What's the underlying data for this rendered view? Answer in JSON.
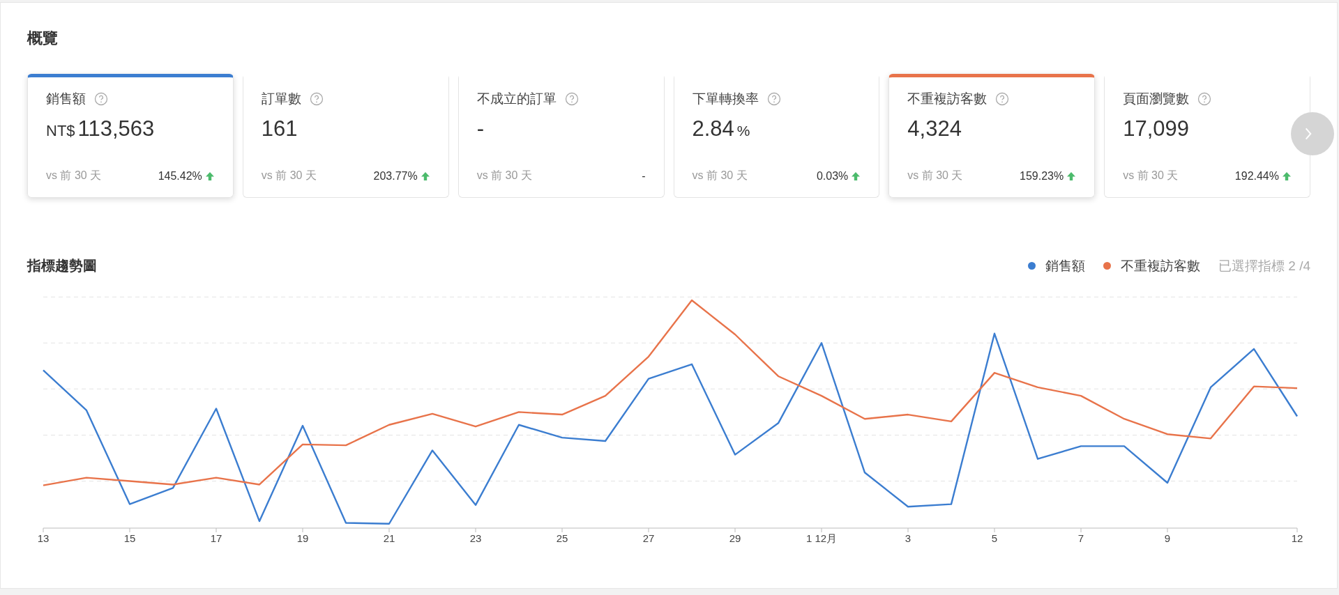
{
  "overview": {
    "title": "概覽",
    "cards": [
      {
        "label": "銷售額",
        "prefix": "NT$",
        "value": "113,563",
        "compare": "vs 前 30 天",
        "change": "145.42%",
        "rising": true,
        "selected": true,
        "color": "#3b7dd0"
      },
      {
        "label": "訂單數",
        "value": "161",
        "compare": "vs 前 30 天",
        "change": "203.77%",
        "rising": true,
        "selected": false
      },
      {
        "label": "不成立的訂單",
        "value": "-",
        "compare": "vs 前 30 天",
        "change": "-",
        "rising": false,
        "selected": false
      },
      {
        "label": "下單轉換率",
        "value": "2.84",
        "suffix": "%",
        "compare": "vs 前 30 天",
        "change": "0.03%",
        "rising": true,
        "selected": false
      },
      {
        "label": "不重複訪客數",
        "value": "4,324",
        "compare": "vs 前 30 天",
        "change": "159.23%",
        "rising": true,
        "selected": true,
        "color": "#e8734a"
      },
      {
        "label": "頁面瀏覽數",
        "value": "17,099",
        "compare": "vs 前 30 天",
        "change": "192.44%",
        "rising": true,
        "selected": false
      }
    ]
  },
  "trend": {
    "title": "指標趨勢圖",
    "legend": [
      {
        "name": "銷售額",
        "color": "#3b7dd0"
      },
      {
        "name": "不重複訪客數",
        "color": "#e8734a"
      }
    ],
    "selection": "已選擇指標 2 /4",
    "x_labels": [
      "13",
      "15",
      "17",
      "19",
      "21",
      "23",
      "25",
      "27",
      "29",
      "1 12月",
      "3",
      "5",
      "7",
      "9",
      "12"
    ]
  }
}
